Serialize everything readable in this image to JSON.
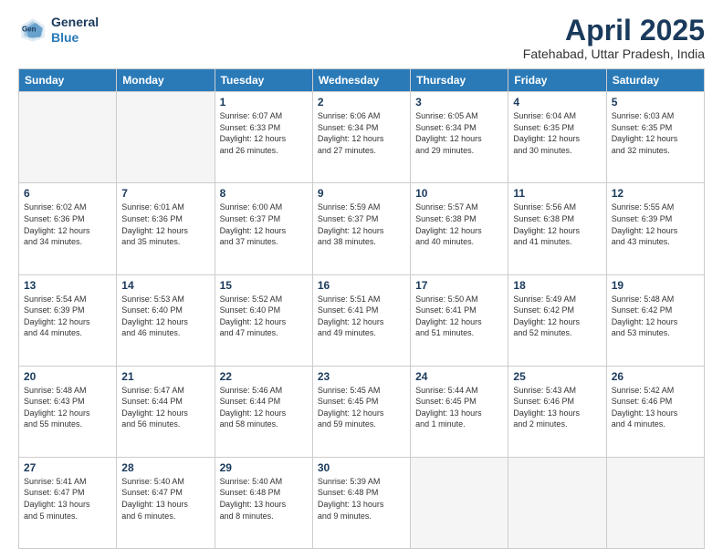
{
  "header": {
    "logo_line1": "General",
    "logo_line2": "Blue",
    "title": "April 2025",
    "subtitle": "Fatehabad, Uttar Pradesh, India"
  },
  "weekdays": [
    "Sunday",
    "Monday",
    "Tuesday",
    "Wednesday",
    "Thursday",
    "Friday",
    "Saturday"
  ],
  "weeks": [
    [
      {
        "num": "",
        "info": ""
      },
      {
        "num": "",
        "info": ""
      },
      {
        "num": "1",
        "info": "Sunrise: 6:07 AM\nSunset: 6:33 PM\nDaylight: 12 hours\nand 26 minutes."
      },
      {
        "num": "2",
        "info": "Sunrise: 6:06 AM\nSunset: 6:34 PM\nDaylight: 12 hours\nand 27 minutes."
      },
      {
        "num": "3",
        "info": "Sunrise: 6:05 AM\nSunset: 6:34 PM\nDaylight: 12 hours\nand 29 minutes."
      },
      {
        "num": "4",
        "info": "Sunrise: 6:04 AM\nSunset: 6:35 PM\nDaylight: 12 hours\nand 30 minutes."
      },
      {
        "num": "5",
        "info": "Sunrise: 6:03 AM\nSunset: 6:35 PM\nDaylight: 12 hours\nand 32 minutes."
      }
    ],
    [
      {
        "num": "6",
        "info": "Sunrise: 6:02 AM\nSunset: 6:36 PM\nDaylight: 12 hours\nand 34 minutes."
      },
      {
        "num": "7",
        "info": "Sunrise: 6:01 AM\nSunset: 6:36 PM\nDaylight: 12 hours\nand 35 minutes."
      },
      {
        "num": "8",
        "info": "Sunrise: 6:00 AM\nSunset: 6:37 PM\nDaylight: 12 hours\nand 37 minutes."
      },
      {
        "num": "9",
        "info": "Sunrise: 5:59 AM\nSunset: 6:37 PM\nDaylight: 12 hours\nand 38 minutes."
      },
      {
        "num": "10",
        "info": "Sunrise: 5:57 AM\nSunset: 6:38 PM\nDaylight: 12 hours\nand 40 minutes."
      },
      {
        "num": "11",
        "info": "Sunrise: 5:56 AM\nSunset: 6:38 PM\nDaylight: 12 hours\nand 41 minutes."
      },
      {
        "num": "12",
        "info": "Sunrise: 5:55 AM\nSunset: 6:39 PM\nDaylight: 12 hours\nand 43 minutes."
      }
    ],
    [
      {
        "num": "13",
        "info": "Sunrise: 5:54 AM\nSunset: 6:39 PM\nDaylight: 12 hours\nand 44 minutes."
      },
      {
        "num": "14",
        "info": "Sunrise: 5:53 AM\nSunset: 6:40 PM\nDaylight: 12 hours\nand 46 minutes."
      },
      {
        "num": "15",
        "info": "Sunrise: 5:52 AM\nSunset: 6:40 PM\nDaylight: 12 hours\nand 47 minutes."
      },
      {
        "num": "16",
        "info": "Sunrise: 5:51 AM\nSunset: 6:41 PM\nDaylight: 12 hours\nand 49 minutes."
      },
      {
        "num": "17",
        "info": "Sunrise: 5:50 AM\nSunset: 6:41 PM\nDaylight: 12 hours\nand 51 minutes."
      },
      {
        "num": "18",
        "info": "Sunrise: 5:49 AM\nSunset: 6:42 PM\nDaylight: 12 hours\nand 52 minutes."
      },
      {
        "num": "19",
        "info": "Sunrise: 5:48 AM\nSunset: 6:42 PM\nDaylight: 12 hours\nand 53 minutes."
      }
    ],
    [
      {
        "num": "20",
        "info": "Sunrise: 5:48 AM\nSunset: 6:43 PM\nDaylight: 12 hours\nand 55 minutes."
      },
      {
        "num": "21",
        "info": "Sunrise: 5:47 AM\nSunset: 6:44 PM\nDaylight: 12 hours\nand 56 minutes."
      },
      {
        "num": "22",
        "info": "Sunrise: 5:46 AM\nSunset: 6:44 PM\nDaylight: 12 hours\nand 58 minutes."
      },
      {
        "num": "23",
        "info": "Sunrise: 5:45 AM\nSunset: 6:45 PM\nDaylight: 12 hours\nand 59 minutes."
      },
      {
        "num": "24",
        "info": "Sunrise: 5:44 AM\nSunset: 6:45 PM\nDaylight: 13 hours\nand 1 minute."
      },
      {
        "num": "25",
        "info": "Sunrise: 5:43 AM\nSunset: 6:46 PM\nDaylight: 13 hours\nand 2 minutes."
      },
      {
        "num": "26",
        "info": "Sunrise: 5:42 AM\nSunset: 6:46 PM\nDaylight: 13 hours\nand 4 minutes."
      }
    ],
    [
      {
        "num": "27",
        "info": "Sunrise: 5:41 AM\nSunset: 6:47 PM\nDaylight: 13 hours\nand 5 minutes."
      },
      {
        "num": "28",
        "info": "Sunrise: 5:40 AM\nSunset: 6:47 PM\nDaylight: 13 hours\nand 6 minutes."
      },
      {
        "num": "29",
        "info": "Sunrise: 5:40 AM\nSunset: 6:48 PM\nDaylight: 13 hours\nand 8 minutes."
      },
      {
        "num": "30",
        "info": "Sunrise: 5:39 AM\nSunset: 6:48 PM\nDaylight: 13 hours\nand 9 minutes."
      },
      {
        "num": "",
        "info": ""
      },
      {
        "num": "",
        "info": ""
      },
      {
        "num": "",
        "info": ""
      }
    ]
  ]
}
